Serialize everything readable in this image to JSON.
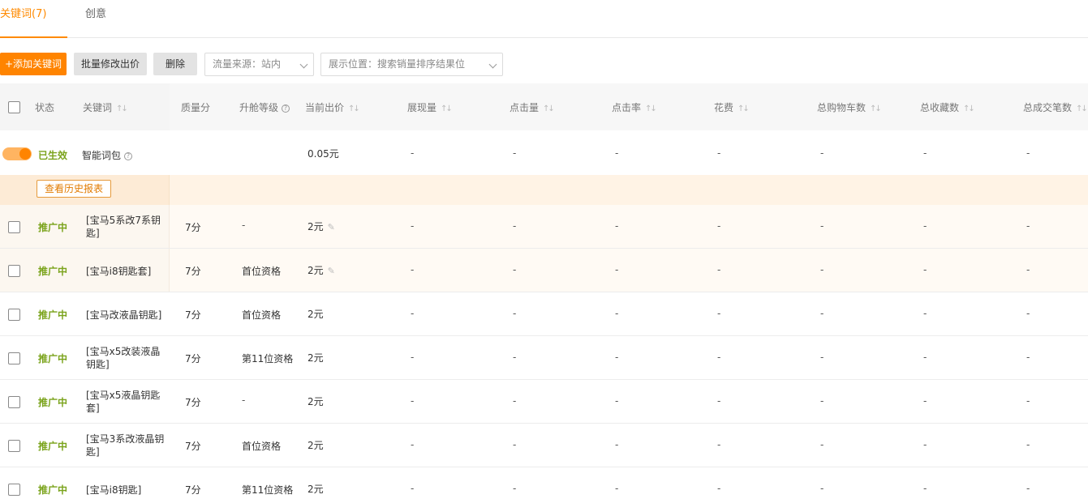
{
  "tabs": [
    {
      "label": "关键词(7)"
    },
    {
      "label": "创意"
    }
  ],
  "toolbar": {
    "add_label": "+添加关键词",
    "batch_label": "批量修改出价",
    "delete_label": "删除",
    "source_select": {
      "label": "流量来源：",
      "value": "站内"
    },
    "position_select": {
      "label": "展示位置：",
      "value": "搜索销量排序结果位"
    }
  },
  "table": {
    "headers": {
      "status": "状态",
      "keyword": "关键词",
      "quality": "质量分",
      "rank": "升舱等级",
      "bid": "当前出价",
      "impressions": "展现量",
      "clicks": "点击量",
      "ctr": "点击率",
      "cost": "花费",
      "cart": "总购物车数",
      "fav": "总收藏数",
      "orders": "总成交笔数"
    },
    "smart": {
      "status": "已生效",
      "keyword": "智能词包",
      "bid": "0.05元",
      "metric": "-",
      "history_label": "查看历史报表"
    },
    "rows": [
      {
        "status": "推广中",
        "keyword": "[宝马5系改7系钥匙]",
        "quality": "7分",
        "rank": "-",
        "bid": "2元",
        "metric": "-"
      },
      {
        "status": "推广中",
        "keyword": "[宝马i8钥匙套]",
        "quality": "7分",
        "rank": "首位资格",
        "bid": "2元",
        "metric": "-"
      },
      {
        "status": "推广中",
        "keyword": "[宝马改液晶钥匙]",
        "quality": "7分",
        "rank": "首位资格",
        "bid": "2元",
        "metric": "-"
      },
      {
        "status": "推广中",
        "keyword": "[宝马x5改装液晶钥匙]",
        "quality": "7分",
        "rank": "第11位资格",
        "bid": "2元",
        "metric": "-"
      },
      {
        "status": "推广中",
        "keyword": "[宝马x5液晶钥匙套]",
        "quality": "7分",
        "rank": "-",
        "bid": "2元",
        "metric": "-"
      },
      {
        "status": "推广中",
        "keyword": "[宝马3系改液晶钥匙]",
        "quality": "7分",
        "rank": "首位资格",
        "bid": "2元",
        "metric": "-"
      },
      {
        "status": "推广中",
        "keyword": "[宝马i8钥匙]",
        "quality": "7分",
        "rank": "第11位资格",
        "bid": "2元",
        "metric": "-"
      }
    ]
  },
  "icons": {
    "sort": "sort-icon",
    "help": "help-icon",
    "edit": "pencil-icon",
    "dropdown": "chevron-down-icon"
  },
  "colors": {
    "accent": "#ff8400",
    "status_green": "#7aa31b"
  }
}
